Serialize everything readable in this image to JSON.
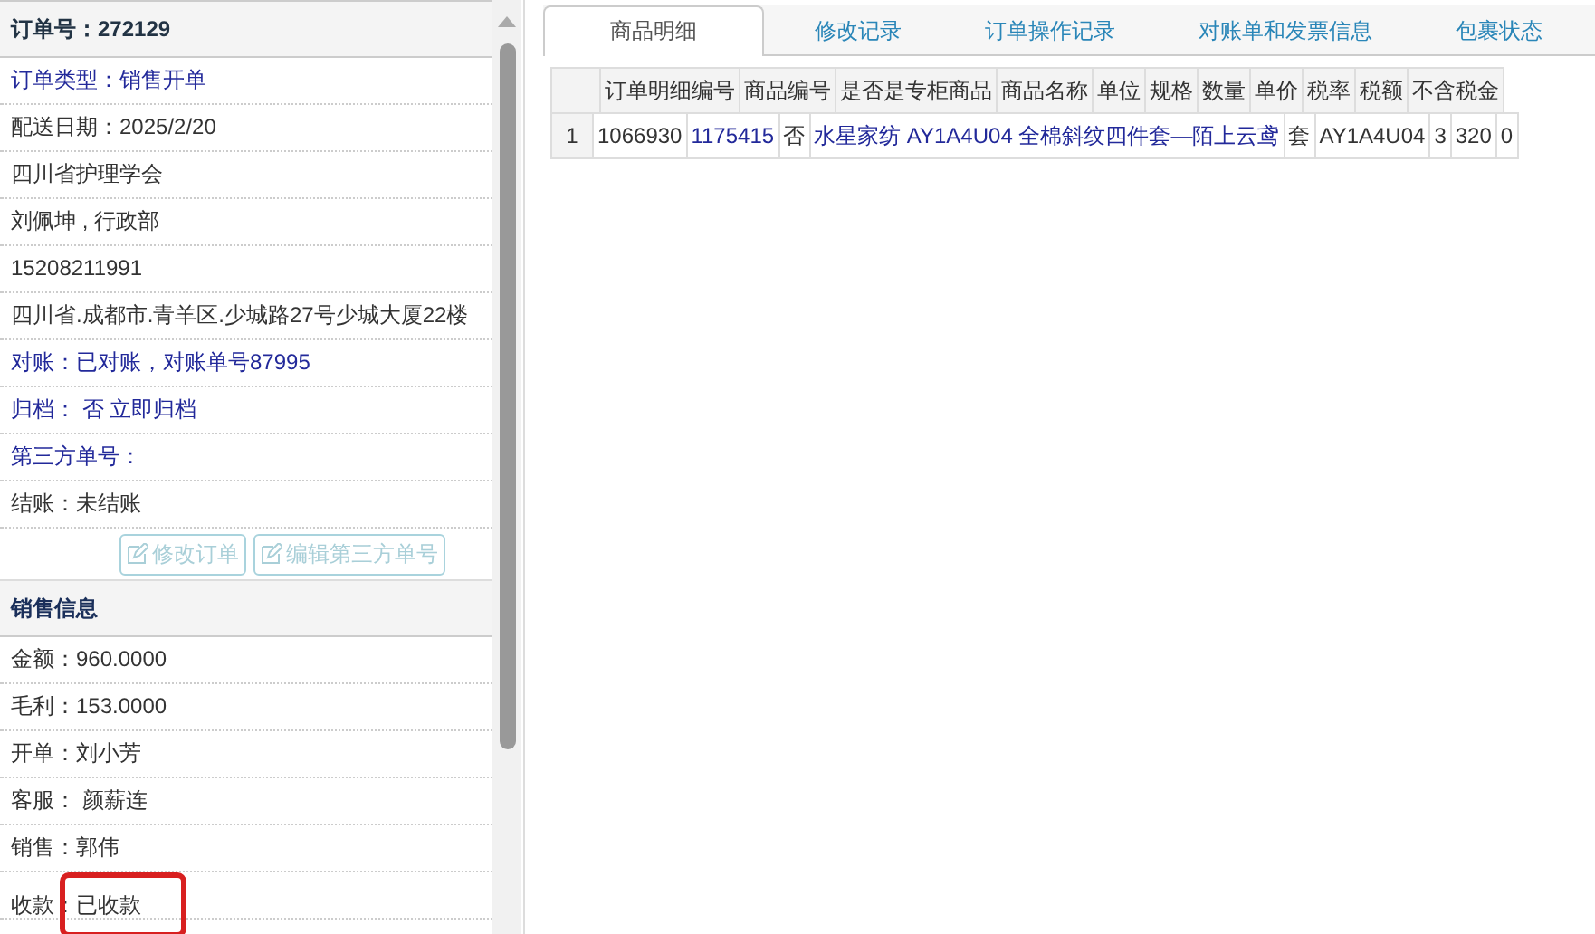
{
  "order_panel": {
    "title": "订单号：272129",
    "rows": [
      {
        "text": "订单类型：销售开单",
        "kind": "link"
      },
      {
        "text": "配送日期：2025/2/20",
        "kind": "plain"
      },
      {
        "text": "四川省护理学会",
        "kind": "plain"
      },
      {
        "text": "刘佩坤 , 行政部",
        "kind": "plain"
      },
      {
        "text": "15208211991",
        "kind": "plain"
      },
      {
        "text": "四川省.成都市.青羊区.少城路27号少城大厦22楼",
        "kind": "plain"
      },
      {
        "text": "对账：已对账，对账单号87995",
        "kind": "link"
      },
      {
        "text": "归档： 否 立即归档",
        "kind": "link"
      },
      {
        "text": "第三方单号：",
        "kind": "link"
      },
      {
        "text": "结账：未结账",
        "kind": "plain"
      }
    ],
    "buttons": [
      {
        "label": "修改订单",
        "disabled": true
      },
      {
        "label": "编辑第三方单号",
        "disabled": true
      }
    ]
  },
  "sales_panel": {
    "title": "销售信息",
    "rows": [
      {
        "label": "金额：",
        "value": "960.0000",
        "highlighted": false
      },
      {
        "label": "毛利：",
        "value": "153.0000",
        "highlighted": false
      },
      {
        "label": "开单：",
        "value": "刘小芳",
        "highlighted": false
      },
      {
        "label": "客服：",
        "value": " 颜薪连",
        "highlighted": false
      },
      {
        "label": "销售：",
        "value": "郭伟",
        "highlighted": false
      },
      {
        "label": "收款：",
        "value": "已收款",
        "highlighted": true
      }
    ]
  },
  "tabs": [
    {
      "label": "商品明细",
      "selected": true
    },
    {
      "label": "修改记录",
      "selected": false
    },
    {
      "label": "订单操作记录",
      "selected": false
    },
    {
      "label": "对账单和发票信息",
      "selected": false
    },
    {
      "label": "包裹状态",
      "selected": false
    }
  ],
  "table": {
    "header_labels": [
      "订单明细编号",
      "商品编号",
      "是否是专柜商品",
      "商品名称",
      "单位",
      "规格",
      "数量",
      "单价",
      "税率",
      "税额",
      "不含税金"
    ],
    "detail_strip": [
      {
        "cells": [
          {
            "text": "1",
            "kind": "index"
          },
          {
            "text": "1066930",
            "kind": "plain"
          },
          {
            "text": "1175415",
            "kind": "link"
          },
          {
            "text": "否",
            "kind": "plain"
          },
          {
            "text": "水星家纺 AY1A4U04 全棉斜纹四件套—陌上云鸢",
            "kind": "link"
          },
          {
            "text": "套",
            "kind": "plain"
          },
          {
            "text": "AY1A4U04",
            "kind": "plain"
          },
          {
            "text": "3",
            "kind": "plain"
          },
          {
            "text": "320",
            "kind": "plain"
          },
          {
            "text": "0",
            "kind": "plain"
          }
        ]
      }
    ]
  }
}
